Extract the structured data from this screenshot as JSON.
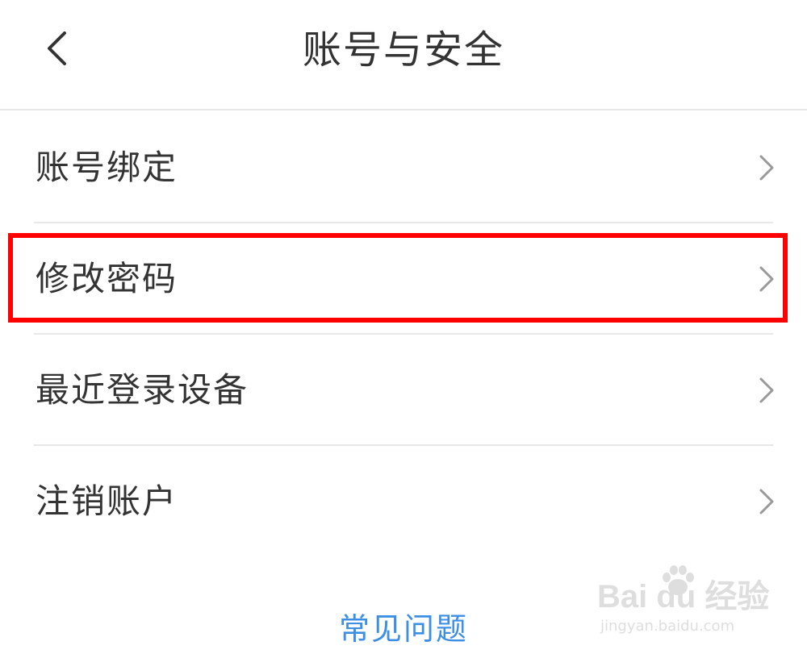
{
  "header": {
    "title": "账号与安全",
    "back_icon": "chevron-left-icon"
  },
  "menu": {
    "items": [
      {
        "label": "账号绑定",
        "icon": "chevron-right-icon"
      },
      {
        "label": "修改密码",
        "icon": "chevron-right-icon",
        "highlighted": true
      },
      {
        "label": "最近登录设备",
        "icon": "chevron-right-icon"
      },
      {
        "label": "注销账户",
        "icon": "chevron-right-icon"
      }
    ]
  },
  "footer": {
    "faq_label": "常见问题"
  },
  "watermark": {
    "main": "Bai du 经验",
    "sub": "jingyan.baidu.com"
  },
  "colors": {
    "highlight": "#ff0000",
    "link": "#3d8fe3",
    "text": "#333333",
    "divider": "#e8e8e8"
  }
}
